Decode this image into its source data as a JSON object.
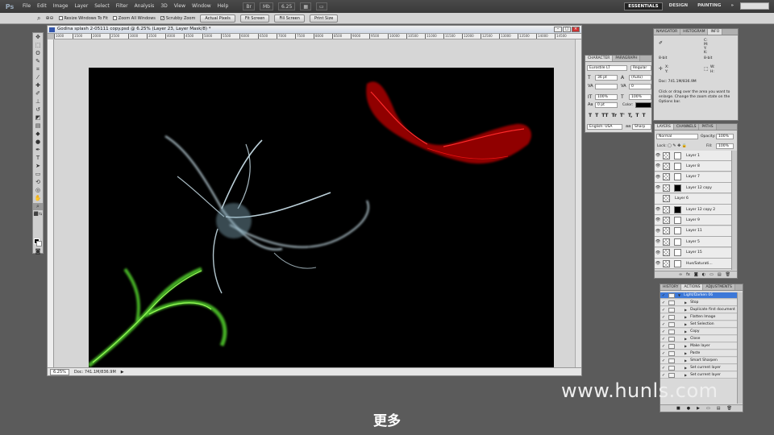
{
  "menubar": {
    "logo": "Ps",
    "items": [
      "File",
      "Edit",
      "Image",
      "Layer",
      "Select",
      "Filter",
      "Analysis",
      "3D",
      "View",
      "Window",
      "Help"
    ],
    "zoom": "6.25",
    "workspaces": [
      "ESSENTIALS",
      "DESIGN",
      "PAINTING"
    ]
  },
  "options": {
    "resize_windows": "Resize Windows To Fit",
    "zoom_all": "Zoom All Windows",
    "scrubby": "Scrubby Zoom",
    "actual_pixels": "Actual Pixels",
    "fit_screen": "Fit Screen",
    "fill_screen": "Fill Screen",
    "print_size": "Print Size"
  },
  "document": {
    "title": "Godina splash 2-05111 copy.psd @ 6.25% (Layer 23, Layer Mask/8) *",
    "zoom": "6.25%",
    "doc_size": "Doc: 741.1M/836.9M",
    "ruler_ticks": [
      "1000",
      "1500",
      "2000",
      "2500",
      "3000",
      "3500",
      "4000",
      "4500",
      "5000",
      "5500",
      "6000",
      "6500",
      "7000",
      "7500",
      "8000",
      "8500",
      "9000",
      "9500",
      "10000",
      "10500",
      "11000",
      "11500",
      "12000",
      "12500",
      "13000",
      "13500",
      "14000",
      "14500"
    ]
  },
  "info_panel": {
    "tabs": [
      "NAVIGATOR",
      "HISTOGRAM",
      "INFO"
    ],
    "bit_left": "8-bit",
    "bit_right": "8-bit",
    "doc": "Doc: 741.1M/836.9M",
    "help": "Click or drag over the area you want to enlarge. Change the zoom state on the Options bar.",
    "labels": [
      "R:",
      "G:",
      "B:",
      "C:",
      "M:",
      "Y:",
      "K:",
      "X:",
      "Y:",
      "W:",
      "H:"
    ]
  },
  "character_panel": {
    "tabs": [
      "CHARACTER",
      "PARAGRAPH"
    ],
    "font": "Eurostile LT",
    "style": "Regular",
    "size": "36 pt",
    "leading": "(Auto)",
    "tracking": "0",
    "kerning": "",
    "vscale": "100%",
    "hscale": "100%",
    "baseline": "0 pt",
    "color_label": "Color:",
    "language": "English: USA",
    "antialias": "Sharp",
    "type_styles": [
      "T",
      "T",
      "TT",
      "Tr",
      "T'",
      "T,",
      "T",
      "T"
    ]
  },
  "layers_panel": {
    "tabs": [
      "LAYERS",
      "CHANNELS",
      "PATHS"
    ],
    "blend": "Normal",
    "opacity_label": "Opacity:",
    "opacity": "100%",
    "lock_label": "Lock:",
    "fill_label": "Fill:",
    "fill": "100%",
    "layers": [
      {
        "name": "Layer 1",
        "mask": "white",
        "visible": true
      },
      {
        "name": "Layer 8",
        "mask": "white",
        "visible": true
      },
      {
        "name": "Layer 7",
        "mask": "white",
        "visible": true
      },
      {
        "name": "Layer 12 copy",
        "mask": "black",
        "visible": true
      },
      {
        "name": "Layer 6",
        "mask": "none",
        "visible": false
      },
      {
        "name": "Layer 12 copy 2",
        "mask": "black",
        "visible": true
      },
      {
        "name": "Layer 9",
        "mask": "white",
        "visible": true
      },
      {
        "name": "Layer 11",
        "mask": "white",
        "visible": true
      },
      {
        "name": "Layer 5",
        "mask": "white",
        "visible": true
      },
      {
        "name": "Layer 15",
        "mask": "white",
        "visible": true
      },
      {
        "name": "Hue/Saturati...",
        "mask": "white",
        "visible": true
      }
    ]
  },
  "actions_panel": {
    "tabs": [
      "HISTORY",
      "ACTIONS",
      "ADJUSTMENTS"
    ],
    "actions": [
      {
        "name": "Light/Darken 06",
        "level": 0,
        "selected": true
      },
      {
        "name": "Stop",
        "level": 1,
        "selected": false
      },
      {
        "name": "Duplicate first document",
        "level": 1,
        "selected": false
      },
      {
        "name": "Flatten Image",
        "level": 1,
        "selected": false
      },
      {
        "name": "Set Selection",
        "level": 1,
        "selected": false
      },
      {
        "name": "Copy",
        "level": 1,
        "selected": false
      },
      {
        "name": "Close",
        "level": 1,
        "selected": false
      },
      {
        "name": "Make layer",
        "level": 1,
        "selected": false
      },
      {
        "name": "Paste",
        "level": 1,
        "selected": false
      },
      {
        "name": "Smart Sharpen",
        "level": 1,
        "selected": false
      },
      {
        "name": "Set current layer",
        "level": 1,
        "selected": false
      },
      {
        "name": "Set current layer",
        "level": 1,
        "selected": false
      }
    ]
  },
  "overlay": {
    "watermark": "www.hunls.com",
    "subtitle": "更多"
  }
}
